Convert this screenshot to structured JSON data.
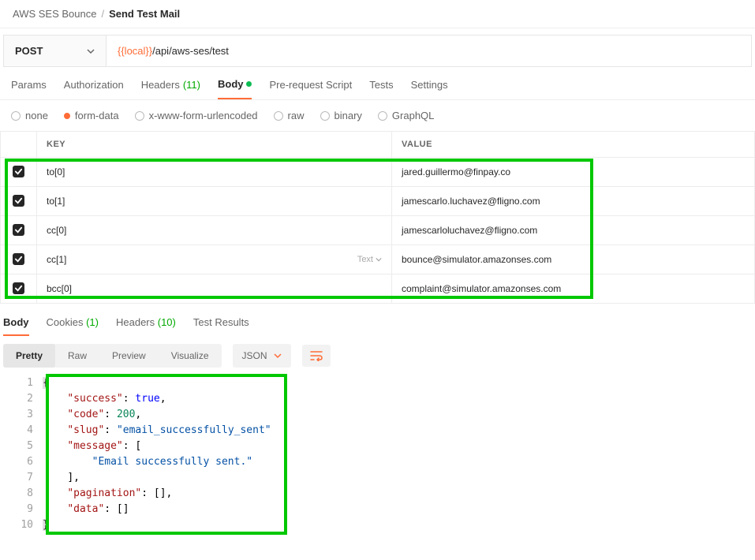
{
  "breadcrumb": {
    "parent": "AWS SES Bounce",
    "sep": "/",
    "current": "Send Test Mail"
  },
  "request": {
    "method": "POST",
    "url_var": "{{local}}",
    "url_path": "/api/aws-ses/test"
  },
  "tabs": {
    "params": "Params",
    "auth": "Authorization",
    "headers_label": "Headers",
    "headers_count": "(11)",
    "body": "Body",
    "prereq": "Pre-request Script",
    "tests": "Tests",
    "settings": "Settings"
  },
  "body_types": {
    "none": "none",
    "formdata": "form-data",
    "xwww": "x-www-form-urlencoded",
    "raw": "raw",
    "binary": "binary",
    "graphql": "GraphQL"
  },
  "table": {
    "key_header": "KEY",
    "value_header": "VALUE",
    "rows": [
      {
        "key": "to[0]",
        "value": "jared.guillermo@finpay.co",
        "type_hint": ""
      },
      {
        "key": "to[1]",
        "value": "jamescarlo.luchavez@fligno.com",
        "type_hint": ""
      },
      {
        "key": "cc[0]",
        "value": "jamescarloluchavez@fligno.com",
        "type_hint": ""
      },
      {
        "key": "cc[1]",
        "value": "bounce@simulator.amazonses.com",
        "type_hint": "Text"
      },
      {
        "key": "bcc[0]",
        "value": "complaint@simulator.amazonses.com",
        "type_hint": ""
      }
    ]
  },
  "response_tabs": {
    "body": "Body",
    "cookies_label": "Cookies",
    "cookies_count": "(1)",
    "headers_label": "Headers",
    "headers_count": "(10)",
    "test_results": "Test Results"
  },
  "view_tabs": {
    "pretty": "Pretty",
    "raw": "Raw",
    "preview": "Preview",
    "visualize": "Visualize"
  },
  "format_select": "JSON",
  "code_lines": {
    "l1": "{",
    "l2": {
      "k": "\"success\"",
      "p": ": ",
      "v": "true",
      "end": ","
    },
    "l3": {
      "k": "\"code\"",
      "p": ": ",
      "v": "200",
      "end": ","
    },
    "l4": {
      "k": "\"slug\"",
      "p": ": ",
      "v": "\"email_successfully_sent\""
    },
    "l5": {
      "k": "\"message\"",
      "p": ": [",
      "end": ""
    },
    "l6": {
      "v": "\"Email successfully sent.\""
    },
    "l7": "],",
    "l8": {
      "k": "\"pagination\"",
      "p": ": [],"
    },
    "l9": {
      "k": "\"data\"",
      "p": ": []"
    },
    "l10": "}"
  },
  "gutter": [
    "1",
    "2",
    "3",
    "4",
    "5",
    "6",
    "7",
    "8",
    "9",
    "10"
  ]
}
